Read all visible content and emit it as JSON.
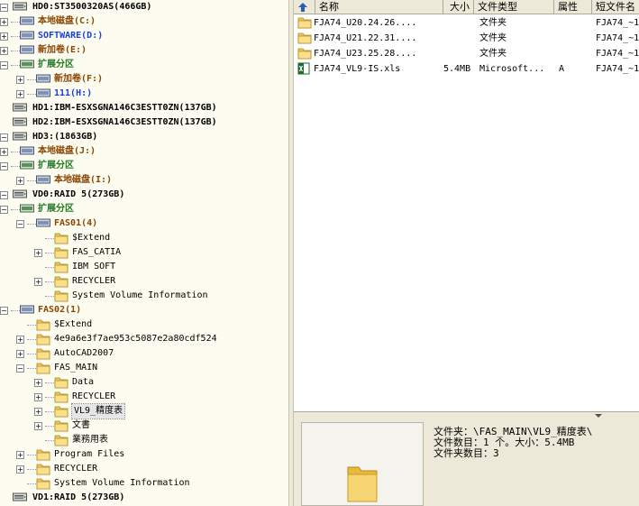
{
  "tree": {
    "items": [
      {
        "label": "HD0:ST3500320AS(466GB)",
        "kind": "disk",
        "toggle": "−",
        "indent": 0
      },
      {
        "label": "本地磁盘(C:)",
        "kind": "local",
        "toggle": "+",
        "indent": 1
      },
      {
        "label": "SOFTWARE(D:)",
        "kind": "blue",
        "toggle": "+",
        "indent": 1
      },
      {
        "label": "新加卷(E:)",
        "kind": "local",
        "toggle": "+",
        "indent": 1
      },
      {
        "label": "扩展分区",
        "kind": "green",
        "toggle": "−",
        "indent": 1
      },
      {
        "label": "新加卷(F:)",
        "kind": "local",
        "toggle": "+",
        "indent": 2
      },
      {
        "label": "111(H:)",
        "kind": "blue",
        "toggle": "+",
        "indent": 2
      },
      {
        "label": "HD1:IBM-ESXSGNA146C3ESTT0ZN(137GB)",
        "kind": "disk",
        "toggle": "",
        "indent": 0
      },
      {
        "label": "HD2:IBM-ESXSGNA146C3ESTT0ZN(137GB)",
        "kind": "disk",
        "toggle": "",
        "indent": 0
      },
      {
        "label": "HD3:(1863GB)",
        "kind": "disk",
        "toggle": "−",
        "indent": 0
      },
      {
        "label": "本地磁盘(J:)",
        "kind": "local",
        "toggle": "+",
        "indent": 1
      },
      {
        "label": "扩展分区",
        "kind": "green",
        "toggle": "−",
        "indent": 1
      },
      {
        "label": "本地磁盘(I:)",
        "kind": "local",
        "toggle": "+",
        "indent": 2
      },
      {
        "label": "VD0:RAID 5(273GB)",
        "kind": "disk",
        "toggle": "−",
        "indent": 0
      },
      {
        "label": "扩展分区",
        "kind": "green",
        "toggle": "−",
        "indent": 1
      },
      {
        "label": "FAS01(4)",
        "kind": "local",
        "toggle": "−",
        "indent": 2
      },
      {
        "label": "$Extend",
        "kind": "folder",
        "toggle": "",
        "indent": 3
      },
      {
        "label": "FAS_CATIA",
        "kind": "folder",
        "toggle": "+",
        "indent": 3
      },
      {
        "label": "IBM SOFT",
        "kind": "folder",
        "toggle": "",
        "indent": 3
      },
      {
        "label": "RECYCLER",
        "kind": "folder",
        "toggle": "+",
        "indent": 3
      },
      {
        "label": "System Volume Information",
        "kind": "folder",
        "toggle": "",
        "indent": 3
      },
      {
        "label": "FAS02(1)",
        "kind": "local",
        "toggle": "−",
        "indent": 1
      },
      {
        "label": "$Extend",
        "kind": "folder",
        "toggle": "",
        "indent": 2
      },
      {
        "label": "4e9a6e3f7ae953c5087e2a80cdf524",
        "kind": "folder",
        "toggle": "+",
        "indent": 2
      },
      {
        "label": "AutoCAD2007",
        "kind": "folder",
        "toggle": "+",
        "indent": 2
      },
      {
        "label": "FAS_MAIN",
        "kind": "folder",
        "toggle": "−",
        "indent": 2
      },
      {
        "label": "Data",
        "kind": "folder",
        "toggle": "+",
        "indent": 3
      },
      {
        "label": "RECYCLER",
        "kind": "folder",
        "toggle": "+",
        "indent": 3
      },
      {
        "label": "VL9_精度表",
        "kind": "folder",
        "toggle": "+",
        "indent": 3,
        "selected": true
      },
      {
        "label": "文書",
        "kind": "folder",
        "toggle": "+",
        "indent": 3
      },
      {
        "label": "業務用表",
        "kind": "folder",
        "toggle": "",
        "indent": 3
      },
      {
        "label": "Program Files",
        "kind": "folder",
        "toggle": "+",
        "indent": 2
      },
      {
        "label": "RECYCLER",
        "kind": "folder",
        "toggle": "+",
        "indent": 2
      },
      {
        "label": "System Volume Information",
        "kind": "folder",
        "toggle": "",
        "indent": 2
      },
      {
        "label": "VD1:RAID 5(273GB)",
        "kind": "disk",
        "toggle": "",
        "indent": 0
      }
    ]
  },
  "list": {
    "headers": [
      "名称",
      "大小",
      "文件类型",
      "属性",
      "短文件名"
    ],
    "rows": [
      {
        "name": "FJA74_U20.24.26....",
        "size": "",
        "type": "文件夹",
        "attr": "",
        "short": "FJA74_~1",
        "icon": "folder"
      },
      {
        "name": "FJA74_U21.22.31....",
        "size": "",
        "type": "文件夹",
        "attr": "",
        "short": "FJA74_~1",
        "icon": "folder"
      },
      {
        "name": "FJA74_U23.25.28....",
        "size": "",
        "type": "文件夹",
        "attr": "",
        "short": "FJA74_~1",
        "icon": "folder"
      },
      {
        "name": "FJA74_VL9-IS.xls",
        "size": "5.4MB",
        "type": "Microsoft...",
        "attr": "A",
        "short": "FJA74_~1",
        "icon": "excel"
      }
    ]
  },
  "info": {
    "folder": "文件夹：\\FAS_MAIN\\VL9_精度表\\",
    "count": "文件数目：1 个。大小：5.4MB",
    "subfolders": "文件夹数目：3"
  },
  "colors": {
    "tree_bg": "#fcfcf0",
    "local": "#8b4500",
    "blue": "#1a3fd6",
    "green": "#1f7a1f",
    "panel": "#ece9d8"
  }
}
